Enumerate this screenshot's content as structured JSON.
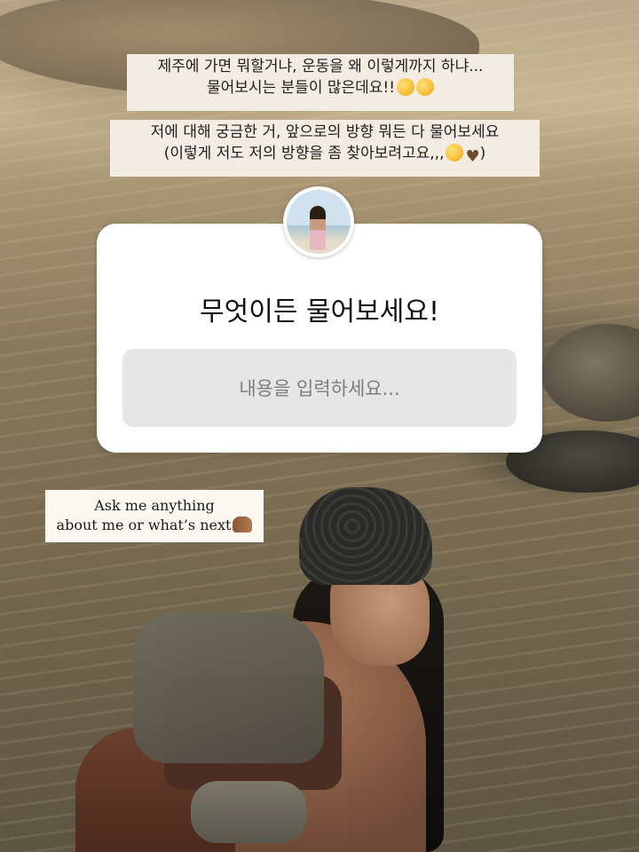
{
  "story": {
    "caption_line1": "제주에 가면 뭐할거냐, 운동을 왜 이렇게까지 하냐...",
    "caption_line2": "물어보시는 분들이 많은데요!!",
    "caption_line3": "저에 대해 궁금한 거, 앞으로의 방향 뭐든 다 물어보세요",
    "caption_line4_pre": "(이렇게 저도 저의 방향을 좀 찾아보려고요,,,",
    "caption_line4_post": ")",
    "emoji_flushed": "flushed-face-icon",
    "emoji_kiss": "kissing-face-icon",
    "emoji_heart": "brown-heart-icon",
    "heart_glyph": "♥"
  },
  "question_sticker": {
    "title": "무엇이든 물어보세요!",
    "input_placeholder": "내용을 입력하세요...",
    "avatar": "profile-avatar"
  },
  "english_tag": {
    "line1": "Ask me anything",
    "line2": "about me or what’s next"
  },
  "colors": {
    "card_bg": "#ffffff",
    "input_bg": "#e6e6e6",
    "caption_bg": "#f3ece2",
    "placeholder": "#7d7d7d"
  }
}
